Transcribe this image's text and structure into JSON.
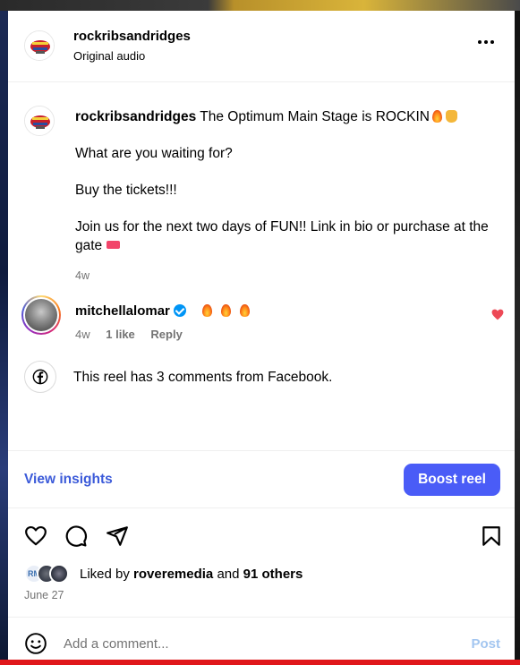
{
  "header": {
    "username": "rockribsandridges",
    "subtitle": "Original audio",
    "more_icon": "more-horizontal-icon"
  },
  "caption": {
    "username": "rockribsandridges",
    "line1": "The Optimum Main Stage is ROCKIN",
    "line2": "What are you waiting for?",
    "line3": "Buy the tickets!!!",
    "line4": "Join us for the next two days of FUN!! Link in bio or purchase at the gate",
    "timestamp": "4w"
  },
  "comment": {
    "username": "mitchellalomar",
    "time": "4w",
    "likes": "1 like",
    "reply": "Reply",
    "like_icon": "heart-filled-icon",
    "heart_color": "#ed4956"
  },
  "facebook": {
    "text": "This reel has 3 comments from Facebook.",
    "icon": "facebook-icon"
  },
  "insights": {
    "view_label": "View insights",
    "boost_label": "Boost reel",
    "accent": "#4a5cf7"
  },
  "actions": {
    "like_icon": "heart-outline-icon",
    "comment_icon": "comment-icon",
    "share_icon": "send-icon",
    "save_icon": "bookmark-icon"
  },
  "likes": {
    "prefix": "Liked by",
    "user": "roveremedia",
    "middle": "and",
    "others": "91 others",
    "avatar1_text": "RM"
  },
  "date": "June 27",
  "add_comment": {
    "placeholder": "Add a comment...",
    "post_label": "Post",
    "emoji_icon": "smiley-icon"
  }
}
